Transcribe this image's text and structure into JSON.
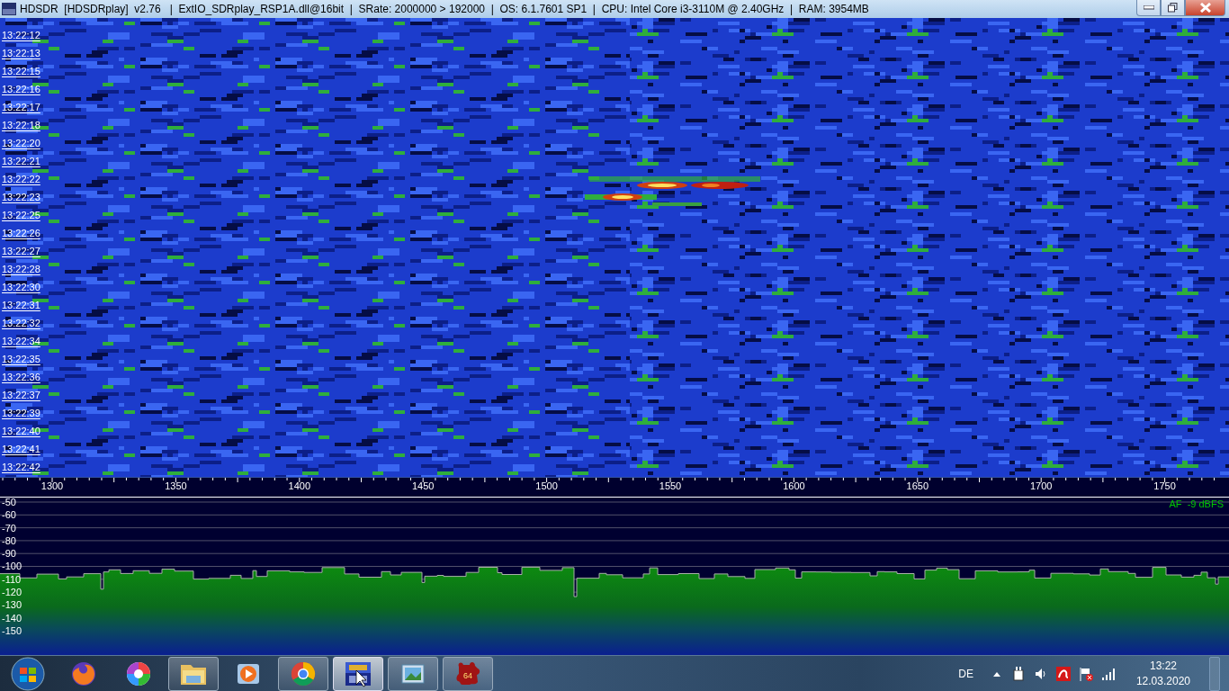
{
  "window": {
    "title": "HDSDR  [HDSDRplay]  v2.76   |  ExtIO_SDRplay_RSP1A.dll@16bit  |  SRate: 2000000 > 192000  |  OS: 6.1.7601 SP1  |  CPU: Intel Core i3-3110M @ 2.40GHz  |  RAM: 3954MB"
  },
  "waterfall": {
    "time_labels": [
      "13:22:12",
      "13:22:13",
      "13:22:15",
      "13:22:16",
      "13:22:17",
      "13:22:18",
      "13:22:20",
      "13:22:21",
      "13:22:22",
      "13:22:23",
      "13:22:25",
      "13:22:26",
      "13:22:27",
      "13:22:28",
      "13:22:30",
      "13:22:31",
      "13:22:32",
      "13:22:34",
      "13:22:35",
      "13:22:36",
      "13:22:37",
      "13:22:39",
      "13:22:40",
      "13:22:41",
      "13:22:42"
    ]
  },
  "frequency_axis": {
    "labels": [
      "1300",
      "1350",
      "1400",
      "1450",
      "1500",
      "1550",
      "1600",
      "1650",
      "1700",
      "1750"
    ]
  },
  "spectrum": {
    "level_labels": [
      "-50",
      "-60",
      "-70",
      "-80",
      "-90",
      "-100",
      "-110",
      "-120",
      "-130",
      "-140",
      "-150"
    ],
    "af_label": "AF  -9 dBFS"
  },
  "taskbar": {
    "items": [
      {
        "kind": "start",
        "running": false,
        "active": false
      },
      {
        "kind": "firefox",
        "running": false,
        "active": false
      },
      {
        "kind": "pinwheel",
        "running": false,
        "active": false
      },
      {
        "kind": "folder",
        "running": true,
        "active": false
      },
      {
        "kind": "media",
        "running": false,
        "active": false
      },
      {
        "kind": "chrome",
        "running": true,
        "active": false
      },
      {
        "kind": "app",
        "running": true,
        "active": true
      },
      {
        "kind": "viewer",
        "running": true,
        "active": false
      },
      {
        "kind": "puzzle",
        "running": true,
        "active": false,
        "badge": "64"
      }
    ],
    "language": "DE",
    "clock": {
      "time": "13:22",
      "date": "12.03.2020"
    }
  }
}
